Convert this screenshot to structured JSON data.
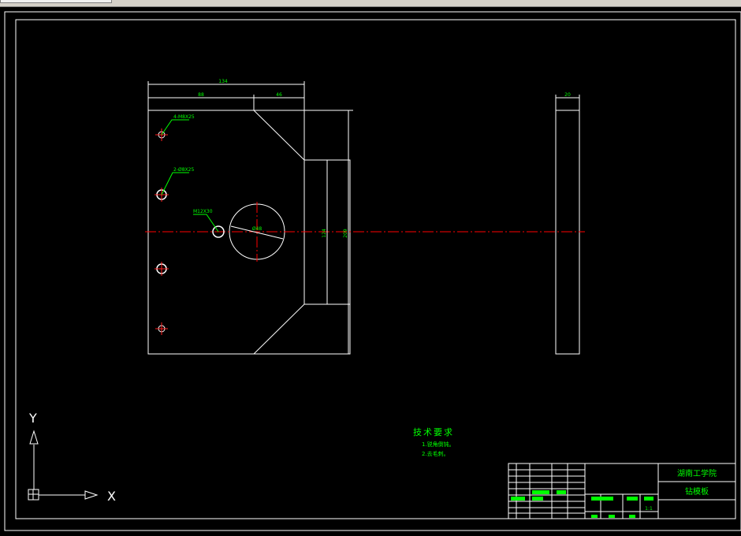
{
  "app": {
    "view": "cad-drawing-canvas"
  },
  "drawing": {
    "dimensions": {
      "overall_width": "134",
      "left_segment": "88",
      "right_segment": "46",
      "inner_height": "124",
      "overall_height": "209",
      "thickness": "20",
      "circle_dia": "Ø48"
    },
    "hole_labels": {
      "h1": "4-M8X25",
      "h2": "2-Ø8X25",
      "h3": "M12X30"
    },
    "ucs": {
      "y": "Y",
      "x": "X"
    },
    "tech_requirements": {
      "title": "技术要求",
      "line1": "1.锐角倒钝。",
      "line2": "2.去毛刺。"
    },
    "title_block": {
      "company": "湖南工学院",
      "part_name": "钻模板",
      "scale": "1:1"
    }
  },
  "colors": {
    "background": "#000000",
    "line": "#ffffff",
    "dimension": "#00ff00",
    "centerline": "#ff0000",
    "hole": "#ff2020"
  }
}
